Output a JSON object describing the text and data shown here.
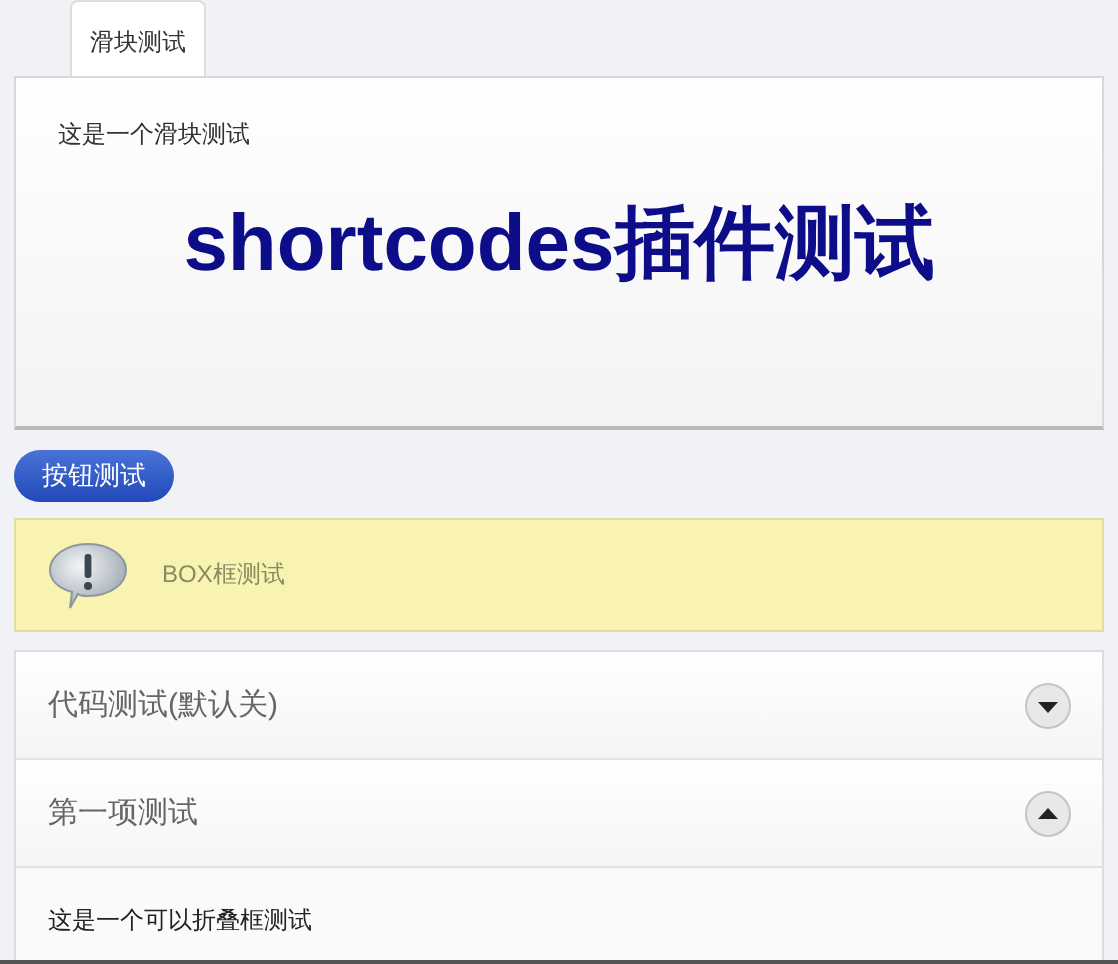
{
  "tabs": [
    {
      "label": "滑块测试",
      "selected": true
    }
  ],
  "slider_panel": {
    "text": "这是一个滑块测试",
    "headline": "shortcodes插件测试"
  },
  "button": {
    "label": "按钮测试"
  },
  "info_box": {
    "text": "BOX框测试"
  },
  "accordion": [
    {
      "title": "代码测试(默认关)",
      "expanded": false
    },
    {
      "title": "第一项测试",
      "expanded": true,
      "content": "这是一个可以折叠框测试"
    }
  ]
}
